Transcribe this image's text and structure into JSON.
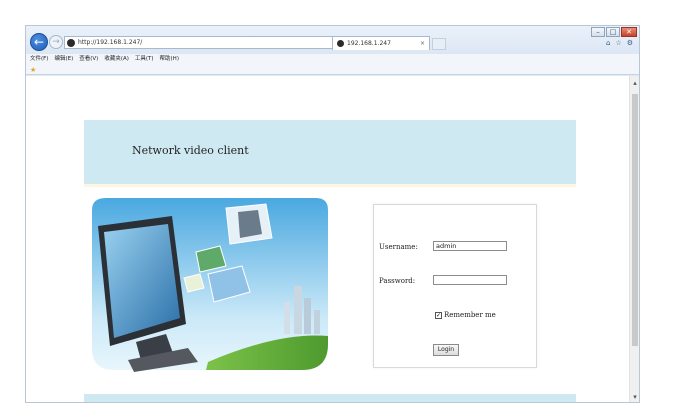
{
  "browser": {
    "address_url": "http://192.168.1.247/",
    "address_tools": "⌕ ▾ ↻",
    "tab_title": "192.168.1.247",
    "tab_close": "×",
    "back_glyph": "←",
    "forward_glyph": "→",
    "window_controls": {
      "minimize": "–",
      "maximize": "□",
      "close": "✕"
    },
    "tool_icons": {
      "home": "⌂",
      "favorites": "☆",
      "settings": "⚙"
    },
    "menu": [
      "文件(F)",
      "编辑(E)",
      "查看(V)",
      "收藏夹(A)",
      "工具(T)",
      "帮助(H)"
    ]
  },
  "page": {
    "title": "Network video client",
    "login": {
      "username_label": "Username:",
      "username_value": "admin",
      "password_label": "Password:",
      "password_value": "",
      "remember_label": "Remember me",
      "remember_checked": true,
      "check_glyph": "✓",
      "login_button": "Login"
    }
  },
  "scrollbar": {
    "up_glyph": "▴",
    "down_glyph": "▾"
  },
  "colors": {
    "header_band": "#cfe9f3",
    "back_button": "#1c5fb9",
    "close_button": "#c7432b"
  }
}
